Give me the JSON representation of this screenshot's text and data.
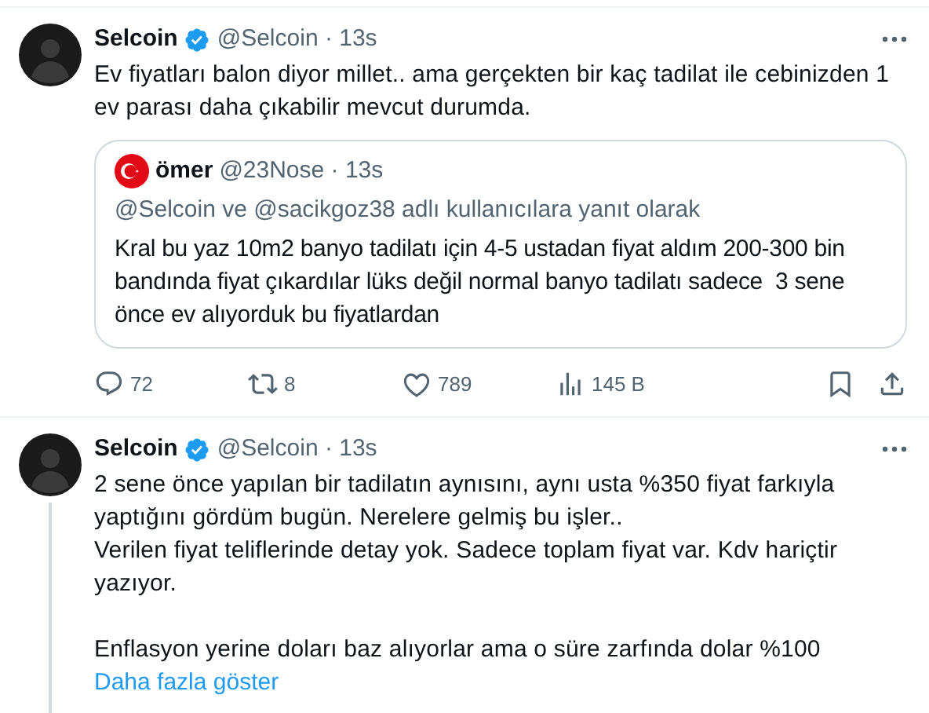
{
  "tweets": [
    {
      "author": {
        "name": "Selcoin",
        "handle": "@Selcoin",
        "separator": "·",
        "time": "13s"
      },
      "verified": true,
      "thread_line": false,
      "text": "Ev fiyatları balon diyor millet.. ama gerçekten bir kaç tadilat ile cebinizden 1 ev parası daha çıkabilir mevcut durumda.",
      "quote": {
        "author": {
          "name": "ömer",
          "handle": "@23Nose",
          "separator": "·",
          "time": "13s"
        },
        "reply_context": "@Selcoin ve @sacikgoz38 adlı kullanıcılara yanıt olarak",
        "text": "Kral bu yaz 10m2 banyo tadilatı için 4-5 ustadan fiyat aldım 200-300 bin bandında fiyat çıkardılar lüks değil normal banyo tadilatı sadece  3 sene önce ev alıyorduk bu fiyatlardan"
      },
      "actions": [
        {
          "kind": "reply",
          "count": "72"
        },
        {
          "kind": "retweet",
          "count": "8"
        },
        {
          "kind": "like",
          "count": "789"
        },
        {
          "kind": "views",
          "count": "145 B"
        },
        {
          "kind": "bookmark"
        },
        {
          "kind": "share"
        }
      ]
    },
    {
      "author": {
        "name": "Selcoin",
        "handle": "@Selcoin",
        "separator": "·",
        "time": "13s"
      },
      "verified": true,
      "thread_line": true,
      "text": "2 sene önce yapılan bir tadilatın aynısını, aynı usta %350 fiyat farkıyla yaptığını gördüm bugün. Nerelere gelmiş bu işler..\nVerilen fiyat teliflerinde detay yok. Sadece toplam fiyat var. Kdv hariçtir yazıyor.\n\nEnflasyon yerine doları baz alıyorlar ama o süre zarfında dolar %100",
      "show_more": "Daha fazla göster"
    }
  ]
}
